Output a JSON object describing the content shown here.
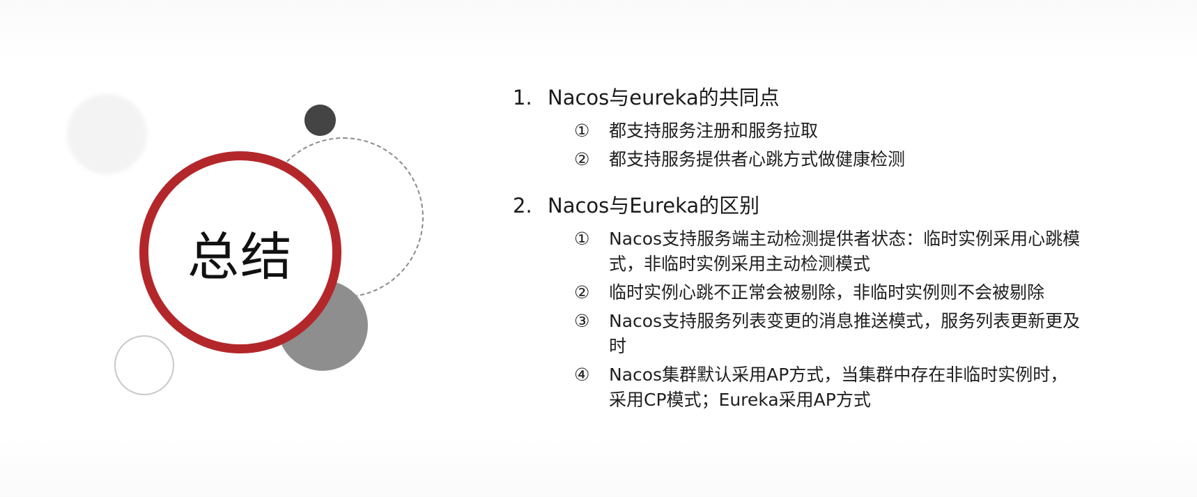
{
  "slide_title": "总结",
  "sections": [
    {
      "number": "1.",
      "title": "Nacos与eureka的共同点",
      "items": [
        {
          "marker": "①",
          "text": "都支持服务注册和服务拉取"
        },
        {
          "marker": "②",
          "text": "都支持服务提供者心跳方式做健康检测"
        }
      ]
    },
    {
      "number": "2.",
      "title": "Nacos与Eureka的区别",
      "items": [
        {
          "marker": "①",
          "text": "Nacos支持服务端主动检测提供者状态：临时实例采用心跳模式，非临时实例采用主动检测模式"
        },
        {
          "marker": "②",
          "text": "临时实例心跳不正常会被剔除，非临时实例则不会被剔除"
        },
        {
          "marker": "③",
          "text": "Nacos支持服务列表变更的消息推送模式，服务列表更新更及时"
        },
        {
          "marker": "④",
          "text": "Nacos集群默认采用AP方式，当集群中存在非临时实例时，采用CP模式；Eureka采用AP方式"
        }
      ]
    }
  ],
  "colors": {
    "accent_red": "#b3272b",
    "dark_grey": "#444444",
    "mid_grey": "#8e8e8e"
  }
}
